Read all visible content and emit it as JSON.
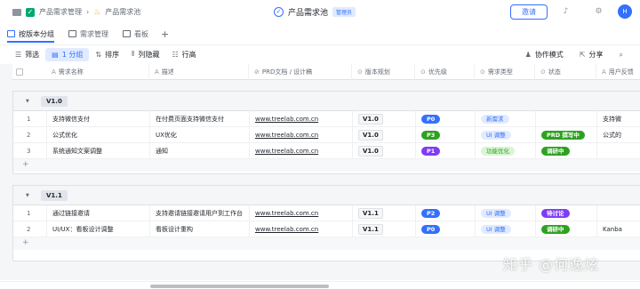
{
  "breadcrumb": {
    "item1": "产品需求管理",
    "item2": "产品需求池"
  },
  "doc": {
    "title": "产品需求池",
    "badge": "管理员"
  },
  "top_actions": {
    "invite": "邀请",
    "avatar": "H"
  },
  "tabs": [
    {
      "label": "按版本分组",
      "active": true
    },
    {
      "label": "需求管理",
      "active": false
    },
    {
      "label": "看板",
      "active": false
    }
  ],
  "toolbar": {
    "filter": "筛选",
    "group": "1 分组",
    "sort": "排序",
    "hide": "列隐藏",
    "row_height": "行高",
    "collab": "协作模式",
    "share": "分享"
  },
  "columns": [
    {
      "label": "需求名称",
      "icon": "A"
    },
    {
      "label": "描述",
      "icon": "A"
    },
    {
      "label": "PRD文档 / 设计稿",
      "icon": "⊘"
    },
    {
      "label": "版本规划",
      "icon": "⊙"
    },
    {
      "label": "优先级",
      "icon": "⊙"
    },
    {
      "label": "需求类型",
      "icon": "⊙"
    },
    {
      "label": "状态",
      "icon": "⊙"
    },
    {
      "label": "用户反馈",
      "icon": "A"
    }
  ],
  "groups": [
    {
      "name": "V1.0",
      "rows": [
        {
          "num": "1",
          "name": "支持微信支付",
          "desc": "在付费页面支持微信支付",
          "link": "www.treelab.com.cn",
          "version": "V1.0",
          "priority": "P0",
          "priority_color": "#3370ff",
          "type": "新需求",
          "type_color": "#e1eaff",
          "type_text": "#3370ff",
          "status": "",
          "status_color": "",
          "feedback": "支持微"
        },
        {
          "num": "2",
          "name": "公式优化",
          "desc": "UX优化",
          "link": "www.treelab.com.cn",
          "version": "V1.0",
          "priority": "P3",
          "priority_color": "#2ea121",
          "type": "UI 调整",
          "type_color": "#e1eaff",
          "type_text": "#3370ff",
          "status": "PRD 撰写中",
          "status_color": "#2ea121",
          "feedback": "公式的"
        },
        {
          "num": "3",
          "name": "系统通知文案调整",
          "desc": "通知",
          "link": "www.treelab.com.cn",
          "version": "V1.0",
          "priority": "P1",
          "priority_color": "#7f3bf5",
          "type": "功能优化",
          "type_color": "#d9f5d6",
          "type_text": "#2ea121",
          "status": "调研中",
          "status_color": "#2ea121",
          "feedback": ""
        }
      ]
    },
    {
      "name": "V1.1",
      "rows": [
        {
          "num": "1",
          "name": "通过链接邀请",
          "desc": "支持邀请链接邀请用户到工作台",
          "link": "www.treelab.com.cn",
          "version": "V1.1",
          "priority": "P2",
          "priority_color": "#3370ff",
          "type": "UI 调整",
          "type_color": "#e1eaff",
          "type_text": "#3370ff",
          "status": "待讨论",
          "status_color": "#7f3bf5",
          "feedback": ""
        },
        {
          "num": "2",
          "name": "UI/UX：看板设计调整",
          "desc": "看板设计重构",
          "link": "www.treelab.com.cn",
          "version": "V1.1",
          "priority": "P0",
          "priority_color": "#3370ff",
          "type": "UI 调整",
          "type_color": "#e1eaff",
          "type_text": "#3370ff",
          "status": "调研中",
          "status_color": "#2ea121",
          "feedback": "Kanba"
        }
      ]
    }
  ],
  "watermark": "知乎 @何逸炫"
}
